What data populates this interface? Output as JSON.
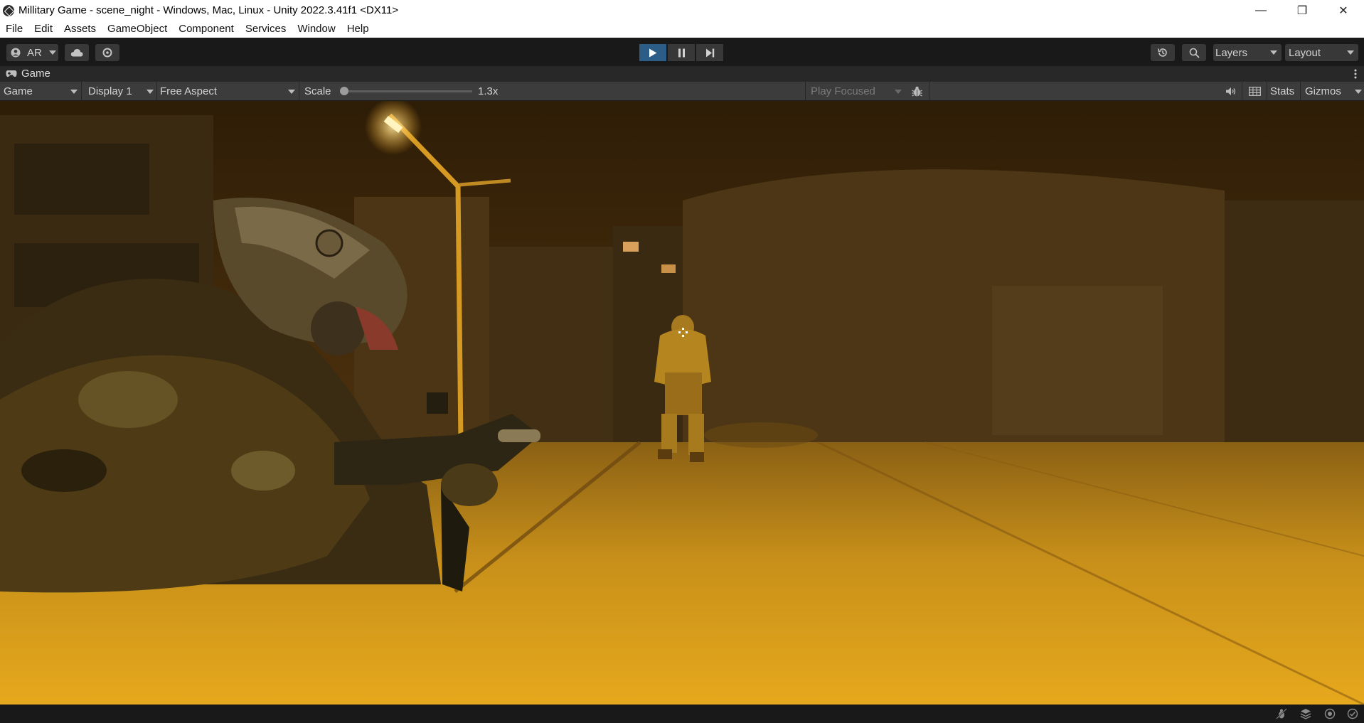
{
  "window": {
    "title": "Millitary Game - scene_night - Windows, Mac, Linux - Unity 2022.3.41f1 <DX11>",
    "minimize": "—",
    "restore": "❐",
    "close": "✕"
  },
  "menu": [
    "File",
    "Edit",
    "Assets",
    "GameObject",
    "Component",
    "Services",
    "Window",
    "Help"
  ],
  "toolbar": {
    "account_label": "AR",
    "layers_label": "Layers",
    "layout_label": "Layout"
  },
  "tab": {
    "label": "Game"
  },
  "game_toolbar": {
    "mode": "Game",
    "display": "Display 1",
    "aspect": "Free Aspect",
    "scale_label": "Scale",
    "scale_value": "1.3x",
    "scale_fraction": 0.0,
    "play_focused": "Play Focused",
    "stats": "Stats",
    "gizmos": "Gizmos"
  },
  "colors": {
    "play_active": "#2c5d87",
    "editor_bg": "#191919",
    "toolbar_bg": "#3c3c3c",
    "scene_amber": "#e0a019"
  },
  "icons": [
    "unity-icon",
    "account-icon",
    "cloud-icon",
    "services-gear-icon",
    "play-icon",
    "pause-icon",
    "step-icon",
    "history-icon",
    "search-icon",
    "gamepad-icon",
    "bug-icon",
    "audio-icon",
    "grid-icon",
    "kebab-icon"
  ]
}
